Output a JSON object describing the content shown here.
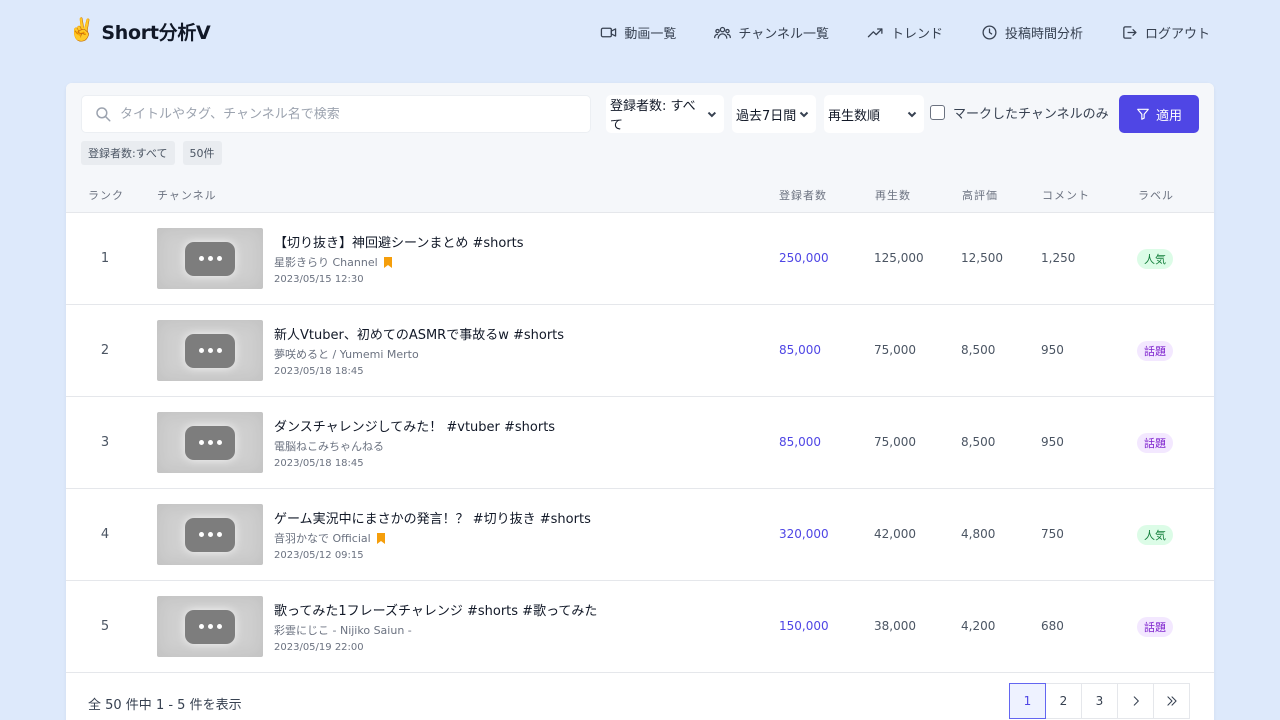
{
  "header": {
    "logo_icon": "✌️",
    "logo_text": "Short分析V",
    "nav": [
      {
        "label": "動画一覧",
        "icon": "video-icon"
      },
      {
        "label": "チャンネル一覧",
        "icon": "users-icon"
      },
      {
        "label": "トレンド",
        "icon": "trending-up-icon"
      },
      {
        "label": "投稿時間分析",
        "icon": "clock-icon"
      },
      {
        "label": "ログアウト",
        "icon": "logout-icon"
      }
    ]
  },
  "filters": {
    "search_placeholder": "タイトルやタグ、チャンネル名で検索",
    "subscribers_select": "登録者数: すべて",
    "period_select": "過去7日間",
    "sort_select": "再生数順",
    "marked_only_label": "マークしたチャンネルのみ",
    "apply_label": "適用",
    "tags": [
      "登録者数:すべて",
      "50件"
    ]
  },
  "table": {
    "headers": {
      "rank": "ランク",
      "channel": "チャンネル",
      "subscribers": "登録者数",
      "views": "再生数",
      "likes": "高評価",
      "comments": "コメント",
      "label": "ラベル"
    },
    "rows": [
      {
        "rank": "1",
        "title": "【切り抜き】神回避シーンまとめ #shorts",
        "channel": "星影きらり Channel",
        "marked": true,
        "date": "2023/05/15 12:30",
        "subscribers": "250,000",
        "views": "125,000",
        "likes": "12,500",
        "comments": "1,250",
        "label": "人気",
        "label_type": "popular"
      },
      {
        "rank": "2",
        "title": "新人Vtuber、初めてのASMRで事故るw #shorts",
        "channel": "夢咲めると / Yumemi Merto",
        "marked": false,
        "date": "2023/05/18 18:45",
        "subscribers": "85,000",
        "views": "75,000",
        "likes": "8,500",
        "comments": "950",
        "label": "話題",
        "label_type": "topic"
      },
      {
        "rank": "3",
        "title": "ダンスチャレンジしてみた！ #vtuber #shorts",
        "channel": "電脳ねこみちゃんねる",
        "marked": false,
        "date": "2023/05/18 18:45",
        "subscribers": "85,000",
        "views": "75,000",
        "likes": "8,500",
        "comments": "950",
        "label": "話題",
        "label_type": "topic"
      },
      {
        "rank": "4",
        "title": "ゲーム実況中にまさかの発言！？ #切り抜き #shorts",
        "channel": "音羽かなで Official",
        "marked": true,
        "date": "2023/05/12 09:15",
        "subscribers": "320,000",
        "views": "42,000",
        "likes": "4,800",
        "comments": "750",
        "label": "人気",
        "label_type": "popular"
      },
      {
        "rank": "5",
        "title": "歌ってみた1フレーズチャレンジ #shorts #歌ってみた",
        "channel": "彩雲にじこ - Nijiko Saiun -",
        "marked": false,
        "date": "2023/05/19 22:00",
        "subscribers": "150,000",
        "views": "38,000",
        "likes": "4,200",
        "comments": "680",
        "label": "話題",
        "label_type": "topic"
      }
    ]
  },
  "footer": {
    "summary": "全 50 件中 1 - 5 件を表示",
    "pages": [
      "1",
      "2",
      "3"
    ],
    "current_page": "1"
  },
  "colors": {
    "background": "#dde9fb",
    "accent": "#4f46e5",
    "popular": "#15803d",
    "topic": "#7e22ce",
    "bookmark": "#f59e0b"
  }
}
